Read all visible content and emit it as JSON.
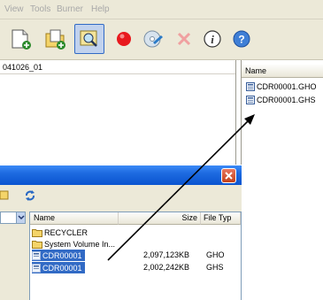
{
  "menu": {
    "view": "View",
    "tools": "Tools",
    "burner": "Burner",
    "help": "Help"
  },
  "left_pane": {
    "path": "041026_01"
  },
  "right_pane": {
    "column_name": "Name",
    "files": [
      {
        "name": "CDR00001.GHO"
      },
      {
        "name": "CDR00001.GHS"
      }
    ]
  },
  "dialog": {
    "columns": {
      "name": "Name",
      "size": "Size",
      "type": "File Typ"
    },
    "rows": [
      {
        "name": "RECYCLER",
        "size": "",
        "type": "",
        "kind": "folder"
      },
      {
        "name": "System Volume In...",
        "size": "",
        "type": "",
        "kind": "folder"
      },
      {
        "name": "CDR00001",
        "size": "2,097,123KB",
        "type": "GHO",
        "kind": "file",
        "selected": true
      },
      {
        "name": "CDR00001",
        "size": "2,002,242KB",
        "type": "GHS",
        "kind": "file",
        "selected": true
      }
    ]
  },
  "icons": {
    "toolbar": [
      "new-document-icon",
      "add-files-icon",
      "find-image-icon",
      "record-icon",
      "erase-disc-icon",
      "delete-icon",
      "info-icon",
      "help-icon"
    ]
  },
  "colors": {
    "selection": "#316ac5",
    "title_bar": "#0a54d0",
    "record_red": "#e8191e"
  }
}
